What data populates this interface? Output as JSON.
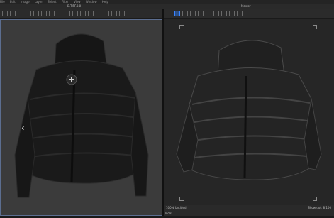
{
  "menubar": {
    "items": [
      "File",
      "Edit",
      "Image",
      "Layer",
      "Select",
      "Filter",
      "View",
      "Window",
      "Help"
    ]
  },
  "left_tab": {
    "title": "B.TIFF.0.0"
  },
  "right_tab": {
    "title": "Master"
  },
  "viewport_left": {
    "arrow": "‹"
  },
  "status": {
    "left": "100% Untitled",
    "right_label": "Show dot: 8",
    "right_value": "100"
  },
  "bottom": {
    "label": "Tools"
  }
}
